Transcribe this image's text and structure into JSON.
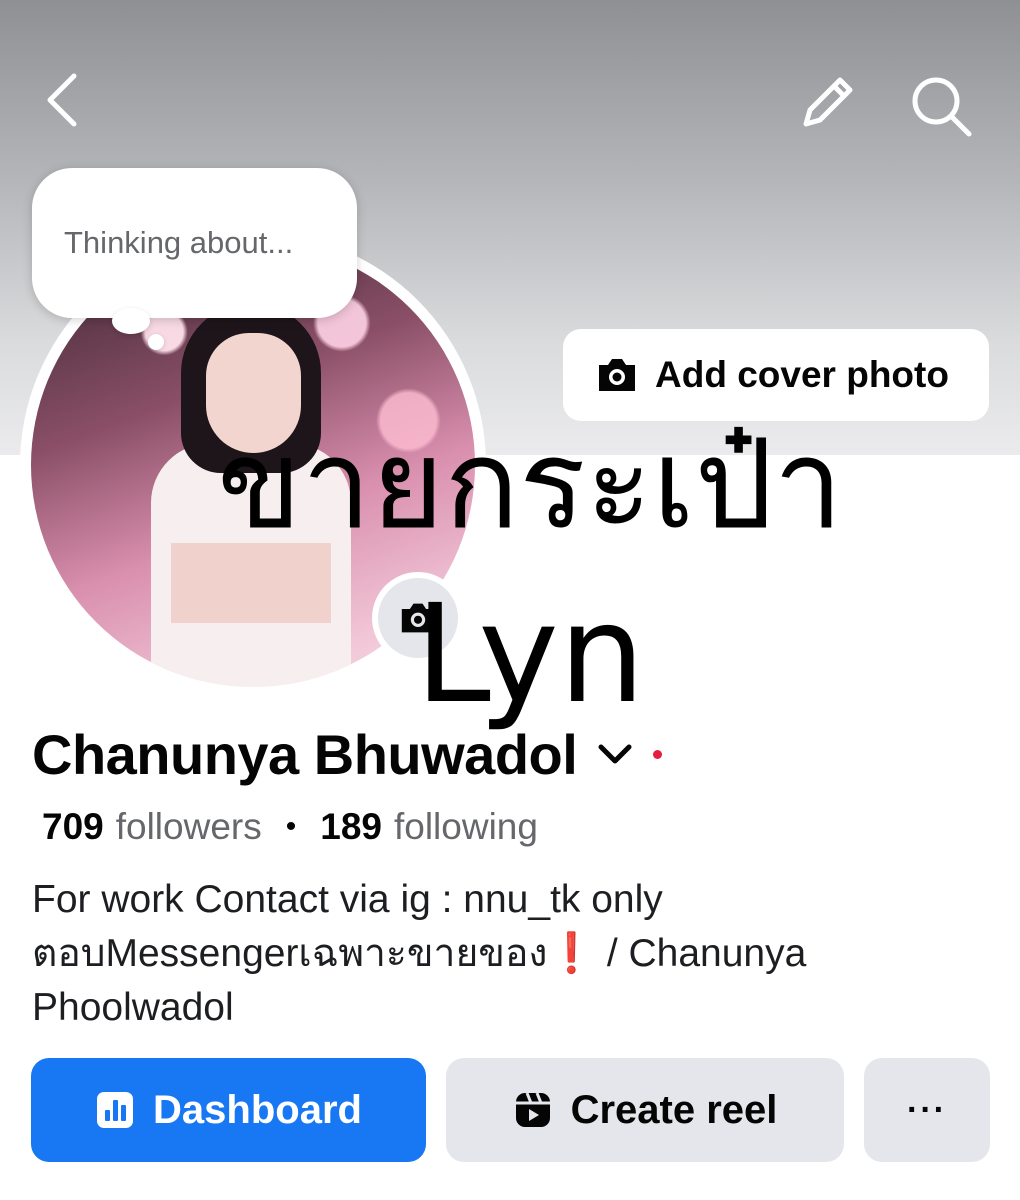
{
  "cover": {
    "add_cover_label": "Add cover photo"
  },
  "status_bubble": {
    "placeholder": "Thinking about..."
  },
  "overlay": {
    "line1": "ขายกระเป๋า",
    "line2": "Lyn"
  },
  "profile": {
    "name": "Chanunya Bhuwadol",
    "followers_count": "709",
    "followers_label": "followers",
    "following_count": "189",
    "following_label": "following",
    "bio_line1": "For work Contact via ig : nnu_tk only",
    "bio_line2_prefix": "ตอบMessengerเฉพาะขายของ",
    "bio_line2_emoji": "❗",
    "bio_line2_suffix": " / Chanunya",
    "bio_line3": "Phoolwadol"
  },
  "actions": {
    "dashboard_label": "Dashboard",
    "create_reel_label": "Create reel",
    "more_label": "···"
  },
  "colors": {
    "primary": "#1877f2",
    "secondary_button": "#e4e6eb",
    "notification_dot": "#e41e3f",
    "muted_text": "#65676b"
  },
  "icons": [
    "back-icon",
    "edit-icon",
    "search-icon",
    "camera-icon",
    "chevron-down-icon",
    "dashboard-icon",
    "reel-icon",
    "more-icon"
  ]
}
